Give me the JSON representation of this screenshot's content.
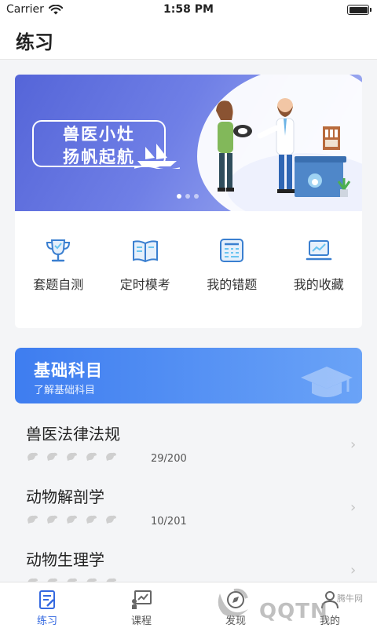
{
  "status_bar": {
    "carrier": "Carrier",
    "time": "1:58 PM"
  },
  "header": {
    "title": "练习"
  },
  "banner": {
    "line1": "兽医小灶",
    "line2": "扬帆起航",
    "slide_count": 3,
    "active_slide": 1
  },
  "quick_actions": [
    {
      "label": "套题自测",
      "icon": "trophy-icon"
    },
    {
      "label": "定时模考",
      "icon": "book-icon"
    },
    {
      "label": "我的错题",
      "icon": "calculator-icon"
    },
    {
      "label": "我的收藏",
      "icon": "laptop-chart-icon"
    }
  ],
  "subjects_section": {
    "title": "基础科目",
    "subtitle": "了解基础科目"
  },
  "subjects": [
    {
      "name": "兽医法律法规",
      "progress": "29/200"
    },
    {
      "name": "动物解剖学",
      "progress": "10/201"
    },
    {
      "name": "动物生理学",
      "progress": ""
    }
  ],
  "tabs": [
    {
      "label": "练习",
      "icon": "practice-icon",
      "active": true
    },
    {
      "label": "课程",
      "icon": "course-icon",
      "active": false
    },
    {
      "label": "发现",
      "icon": "discover-icon",
      "active": false
    },
    {
      "label": "我的",
      "icon": "profile-icon",
      "active": false
    }
  ],
  "watermark": {
    "brand": "QQTN",
    "site": "腾牛网"
  },
  "colors": {
    "accent": "#3569e0",
    "icon_blue": "#3a7fd0",
    "banner_start": "#5565d8",
    "section_start": "#3e7df0"
  }
}
